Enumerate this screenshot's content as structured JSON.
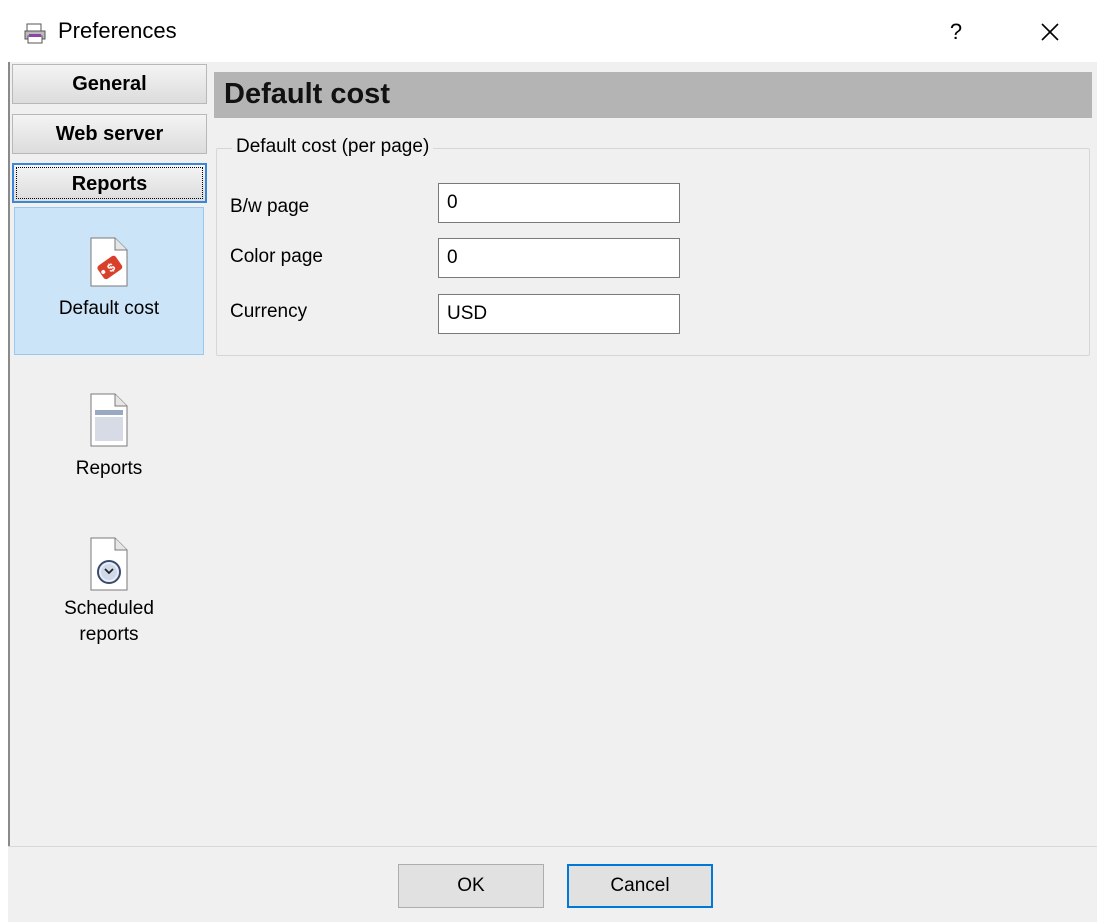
{
  "window": {
    "title": "Preferences",
    "help_label": "?",
    "close_icon": "close-icon",
    "app_icon": "printer-icon"
  },
  "nav": {
    "tabs": [
      {
        "label": "General",
        "active": false
      },
      {
        "label": "Web server",
        "active": false
      },
      {
        "label": "Reports",
        "active": true
      }
    ],
    "items": [
      {
        "label": "Default cost",
        "icon": "price-tag-document-icon",
        "selected": true
      },
      {
        "label": "Reports",
        "icon": "report-document-icon",
        "selected": false
      },
      {
        "label": "Scheduled reports",
        "icon": "clock-document-icon",
        "selected": false
      }
    ]
  },
  "content": {
    "heading": "Default cost",
    "group_label": "Default cost (per page)",
    "fields": [
      {
        "label": "B/w page",
        "value": "0"
      },
      {
        "label": "Color page",
        "value": "0"
      },
      {
        "label": "Currency",
        "value": "USD"
      }
    ]
  },
  "footer": {
    "ok_label": "OK",
    "cancel_label": "Cancel"
  },
  "colors": {
    "heading_bar": "#b4b4b4",
    "selection": "#cce4f7",
    "focus": "#0078d7"
  }
}
